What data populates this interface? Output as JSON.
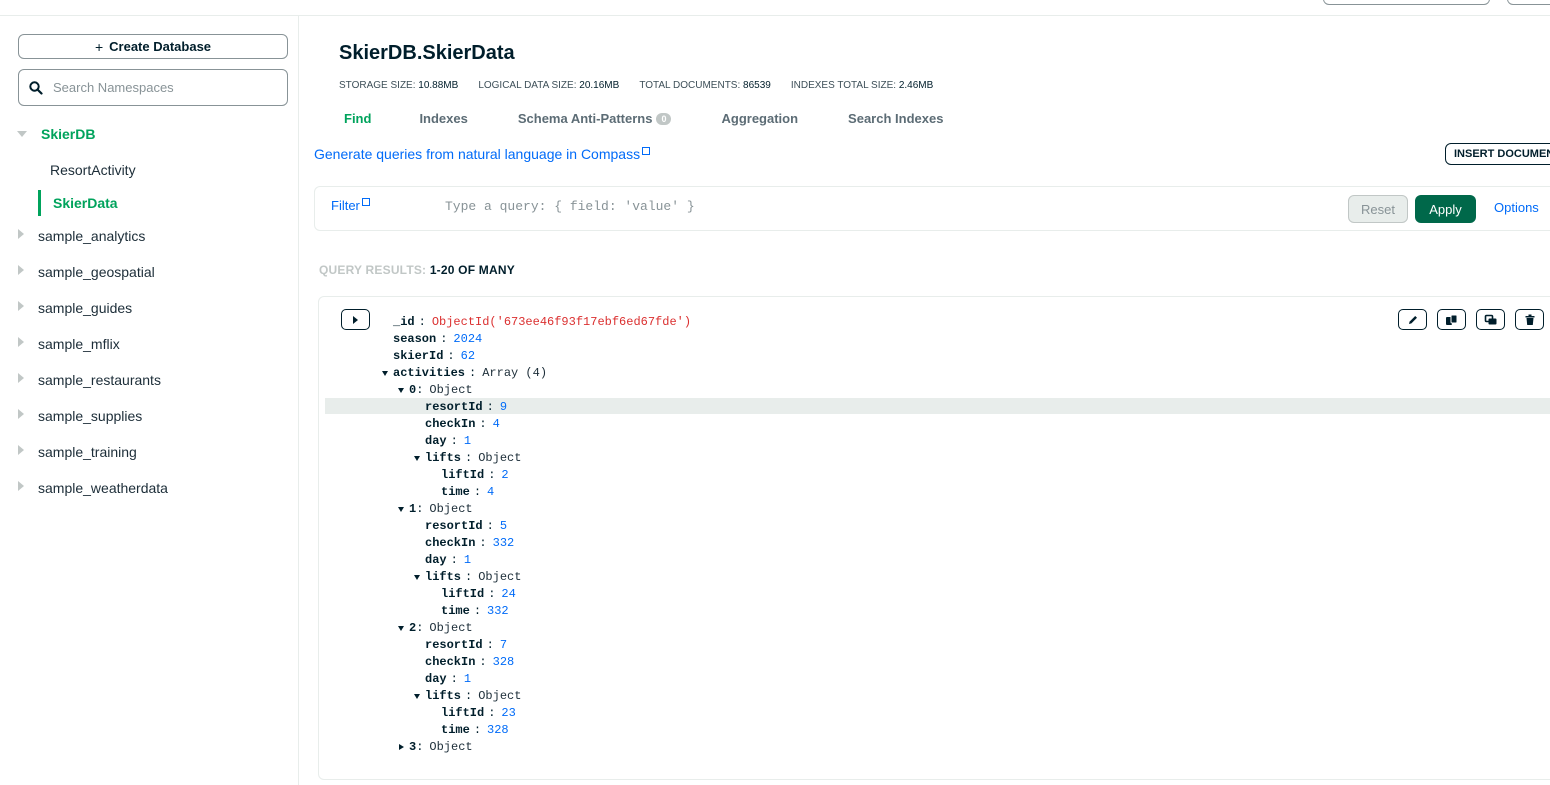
{
  "sidebar": {
    "create_db_label": "Create Database",
    "search_placeholder": "Search Namespaces",
    "tree": [
      {
        "label": "SkierDB",
        "type": "db",
        "expanded": true,
        "active": true
      },
      {
        "label": "ResortActivity",
        "type": "collection"
      },
      {
        "label": "SkierData",
        "type": "collection",
        "active": true
      },
      {
        "label": "sample_analytics",
        "type": "db"
      },
      {
        "label": "sample_geospatial",
        "type": "db"
      },
      {
        "label": "sample_guides",
        "type": "db"
      },
      {
        "label": "sample_mflix",
        "type": "db"
      },
      {
        "label": "sample_restaurants",
        "type": "db"
      },
      {
        "label": "sample_supplies",
        "type": "db"
      },
      {
        "label": "sample_training",
        "type": "db"
      },
      {
        "label": "sample_weatherdata",
        "type": "db"
      }
    ]
  },
  "header": {
    "title": "SkierDB.SkierData",
    "stats": [
      {
        "key": "STORAGE SIZE:",
        "value": "10.88MB"
      },
      {
        "key": "LOGICAL DATA SIZE:",
        "value": "20.16MB"
      },
      {
        "key": "TOTAL DOCUMENTS:",
        "value": "86539"
      },
      {
        "key": "INDEXES TOTAL SIZE:",
        "value": "2.46MB"
      }
    ]
  },
  "tabs": [
    {
      "label": "Find",
      "active": true
    },
    {
      "label": "Indexes"
    },
    {
      "label": "Schema Anti-Patterns",
      "badge": "0"
    },
    {
      "label": "Aggregation"
    },
    {
      "label": "Search Indexes"
    }
  ],
  "nl_query_link": "Generate queries from natural language in Compass",
  "insert_button": "INSERT DOCUMENT",
  "filter": {
    "label": "Filter",
    "placeholder": "Type a query: { field: 'value' }",
    "reset": "Reset",
    "apply": "Apply",
    "options": "Options"
  },
  "results": {
    "label": "QUERY RESULTS:",
    "value": "1-20 OF MANY"
  },
  "document": {
    "lines": [
      {
        "indent": 0,
        "key": "_id",
        "value": "ObjectId('673ee46f93f17ebf6ed67fde')",
        "vtype": "oid"
      },
      {
        "indent": 0,
        "key": "season",
        "value": "2024",
        "vtype": "num"
      },
      {
        "indent": 0,
        "key": "skierId",
        "value": "62",
        "vtype": "num"
      },
      {
        "indent": 0,
        "key": "activities",
        "value": "Array (4)",
        "vtype": "type",
        "toggle": "down"
      },
      {
        "indent": 1,
        "key": "0",
        "value": "Object",
        "vtype": "type",
        "toggle": "down",
        "compact": true
      },
      {
        "indent": 2,
        "key": "resortId",
        "value": "9",
        "vtype": "num"
      },
      {
        "indent": 2,
        "key": "checkIn",
        "value": "4",
        "vtype": "num"
      },
      {
        "indent": 2,
        "key": "day",
        "value": "1",
        "vtype": "num"
      },
      {
        "indent": 2,
        "key": "lifts",
        "value": "Object",
        "vtype": "type",
        "toggle": "down"
      },
      {
        "indent": 3,
        "key": "liftId",
        "value": "2",
        "vtype": "num"
      },
      {
        "indent": 3,
        "key": "time",
        "value": "4",
        "vtype": "num"
      },
      {
        "indent": 1,
        "key": "1",
        "value": "Object",
        "vtype": "type",
        "toggle": "down",
        "compact": true
      },
      {
        "indent": 2,
        "key": "resortId",
        "value": "5",
        "vtype": "num"
      },
      {
        "indent": 2,
        "key": "checkIn",
        "value": "332",
        "vtype": "num"
      },
      {
        "indent": 2,
        "key": "day",
        "value": "1",
        "vtype": "num"
      },
      {
        "indent": 2,
        "key": "lifts",
        "value": "Object",
        "vtype": "type",
        "toggle": "down"
      },
      {
        "indent": 3,
        "key": "liftId",
        "value": "24",
        "vtype": "num"
      },
      {
        "indent": 3,
        "key": "time",
        "value": "332",
        "vtype": "num"
      },
      {
        "indent": 1,
        "key": "2",
        "value": "Object",
        "vtype": "type",
        "toggle": "down",
        "compact": true
      },
      {
        "indent": 2,
        "key": "resortId",
        "value": "7",
        "vtype": "num"
      },
      {
        "indent": 2,
        "key": "checkIn",
        "value": "328",
        "vtype": "num"
      },
      {
        "indent": 2,
        "key": "day",
        "value": "1",
        "vtype": "num"
      },
      {
        "indent": 2,
        "key": "lifts",
        "value": "Object",
        "vtype": "type",
        "toggle": "down"
      },
      {
        "indent": 3,
        "key": "liftId",
        "value": "23",
        "vtype": "num"
      },
      {
        "indent": 3,
        "key": "time",
        "value": "328",
        "vtype": "num"
      },
      {
        "indent": 1,
        "key": "3",
        "value": "Object",
        "vtype": "type",
        "toggle": "right",
        "compact": true
      }
    ],
    "actions": [
      {
        "name": "edit-document-button",
        "icon": "pencil-icon"
      },
      {
        "name": "copy-document-button",
        "icon": "copy-icon"
      },
      {
        "name": "clone-document-button",
        "icon": "clone-icon"
      },
      {
        "name": "delete-document-button",
        "icon": "trash-icon"
      }
    ]
  }
}
